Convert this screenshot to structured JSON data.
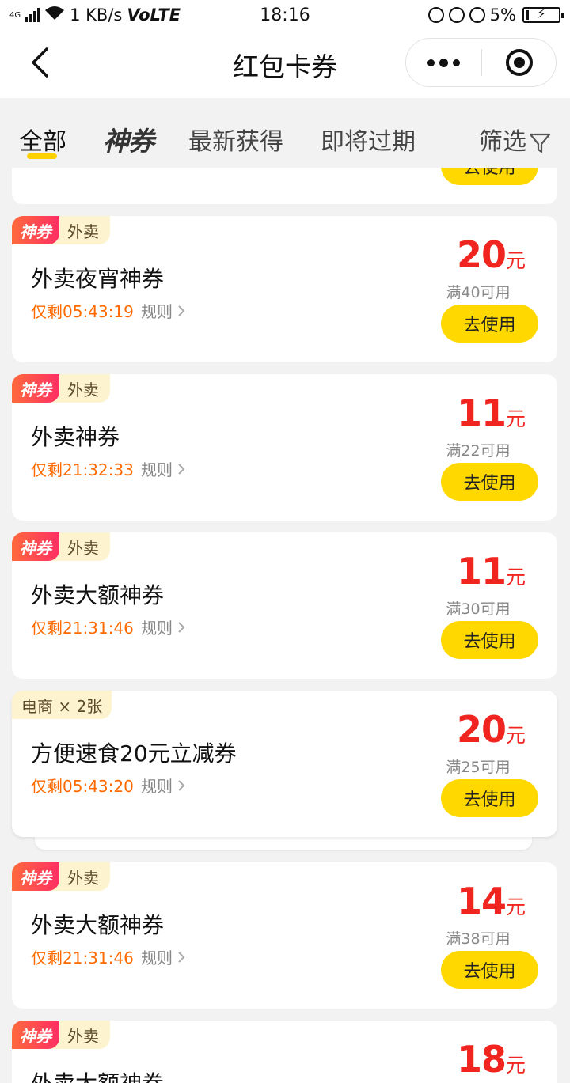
{
  "status_bar": {
    "network": "4G",
    "speed": "1 KB/s",
    "volte": "VoLTE",
    "time": "18:16",
    "battery": "5%"
  },
  "header": {
    "title": "红包卡券",
    "back_icon": "chevron-left-icon",
    "more_icon": "more-dots-icon",
    "close_icon": "target-close-icon"
  },
  "tabs": {
    "all": "全部",
    "shen": "神券",
    "latest": "最新获得",
    "expiring": "即将过期",
    "filter": "筛选"
  },
  "colors": {
    "accent_yellow": "#ffd800",
    "price_red": "#f0251f",
    "expiry_orange": "#ff6a00",
    "badge_gradient_start": "#ff6a3d",
    "badge_gradient_end": "#ff2e63"
  },
  "partial_top_card": {
    "button": "去使用"
  },
  "coupons": [
    {
      "badge_shen": "神券",
      "badge_cat": "外卖",
      "name": "外卖夜宵神券",
      "expiry": "仅剩05:43:19",
      "rules": "规则",
      "amount": "20",
      "unit": "元",
      "condition": "满40可用",
      "button": "去使用"
    },
    {
      "badge_shen": "神券",
      "badge_cat": "外卖",
      "name": "外卖神券",
      "expiry": "仅剩21:32:33",
      "rules": "规则",
      "amount": "11",
      "unit": "元",
      "condition": "满22可用",
      "button": "去使用"
    },
    {
      "badge_shen": "神券",
      "badge_cat": "外卖",
      "name": "外卖大额神券",
      "expiry": "仅剩21:31:46",
      "rules": "规则",
      "amount": "11",
      "unit": "元",
      "condition": "满30可用",
      "button": "去使用"
    },
    {
      "badge_only": "电商 × 2张",
      "name": "方便速食20元立减券",
      "expiry": "仅剩05:43:20",
      "rules": "规则",
      "amount": "20",
      "unit": "元",
      "condition": "满25可用",
      "button": "去使用"
    },
    {
      "badge_shen": "神券",
      "badge_cat": "外卖",
      "name": "外卖大额神券",
      "expiry": "仅剩21:31:46",
      "rules": "规则",
      "amount": "14",
      "unit": "元",
      "condition": "满38可用",
      "button": "去使用"
    },
    {
      "badge_shen": "神券",
      "badge_cat": "外卖",
      "name": "外卖大额神券",
      "amount": "18",
      "unit": "元"
    }
  ]
}
